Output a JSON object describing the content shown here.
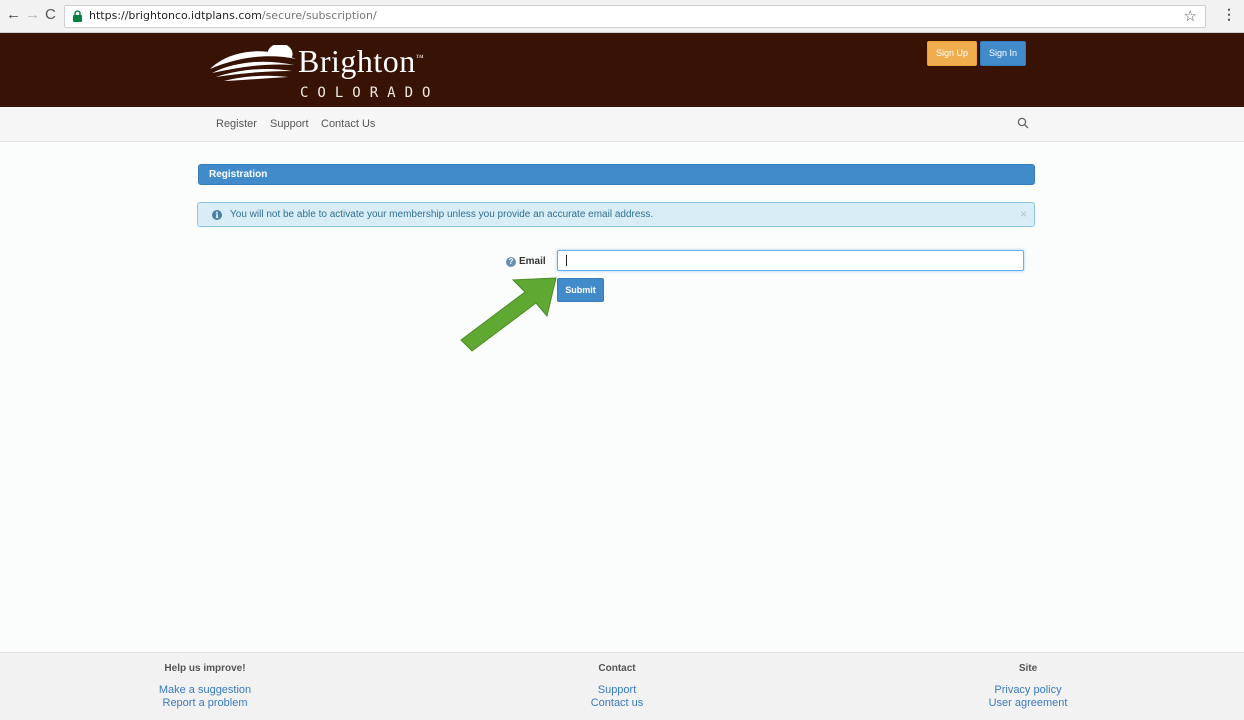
{
  "browser": {
    "back": "←",
    "forward": "→",
    "reload": "C",
    "url_host": "https://brightonco.idtplans.com",
    "url_path": "/secure/subscription/",
    "star": "☆",
    "menu": "⋮"
  },
  "header": {
    "brand": "Brighton",
    "tm": "™",
    "subtitle": "COLORADO",
    "signup_label": "Sign Up",
    "signin_label": "Sign In",
    "colors": {
      "background": "#381303",
      "signup": "#f0ad4e",
      "signin": "#428bca"
    }
  },
  "subnav": {
    "items": [
      {
        "label": "Register"
      },
      {
        "label": "Support"
      },
      {
        "label": "Contact Us"
      }
    ],
    "search_icon": "search-icon"
  },
  "main": {
    "panel_title": "Registration",
    "alert": {
      "icon": "i",
      "message": "You will not be able to activate your membership unless you provide an accurate email address.",
      "close": "×"
    },
    "form": {
      "help_icon": "?",
      "email_label": "Email",
      "email_value": "",
      "submit_label": "Submit"
    }
  },
  "footer": {
    "columns": [
      {
        "heading": "Help us improve!",
        "links": [
          "Make a suggestion",
          "Report a problem"
        ]
      },
      {
        "heading": "Contact",
        "links": [
          "Support",
          "Contact us"
        ]
      },
      {
        "heading": "Site",
        "links": [
          "Privacy policy",
          "User agreement"
        ]
      }
    ]
  }
}
